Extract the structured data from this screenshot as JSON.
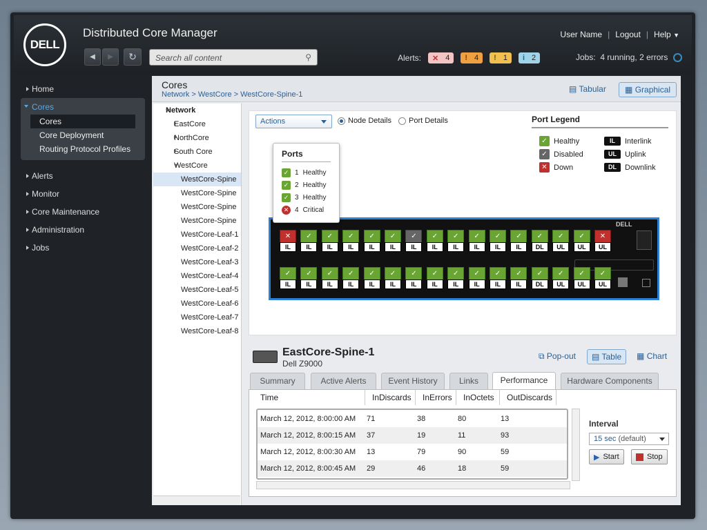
{
  "header": {
    "logo": "DELL",
    "app_title": "Distributed Core Manager",
    "user": "User Name",
    "logout": "Logout",
    "help": "Help",
    "search_placeholder": "Search all content",
    "alerts_label": "Alerts:",
    "alerts": [
      {
        "icon": "✕",
        "count": "4",
        "color": "#f3c4c4"
      },
      {
        "icon": "!",
        "count": "4",
        "color": "#f0a040"
      },
      {
        "icon": "!",
        "count": "1",
        "color": "#f2c050"
      },
      {
        "icon": "i",
        "count": "2",
        "color": "#9fd3e8"
      }
    ],
    "jobs": "Jobs:",
    "jobs_text": "4 running, 2 errors"
  },
  "sidebar": {
    "home": "Home",
    "cores": "Cores",
    "cores_sub": [
      "Cores",
      "Core Deployment",
      "Routing Protocol Profiles"
    ],
    "rest": [
      "Alerts",
      "Monitor",
      "Core Maintenance",
      "Administration",
      "Jobs"
    ]
  },
  "content": {
    "title": "Cores",
    "breadcrumb": "Network > WestCore > WestCore-Spine-1",
    "tabular": "Tabular",
    "graphical": "Graphical"
  },
  "tree": {
    "root": "Network",
    "nodes": [
      "EastCore",
      "NorthCore",
      "South Core",
      "WestCore"
    ],
    "children": [
      "WestCore-Spine",
      "WestCore-Spine",
      "WestCore-Spine",
      "WestCore-Spine",
      "WestCore-Leaf-1",
      "WestCore-Leaf-2",
      "WestCore-Leaf-3",
      "WestCore-Leaf-4",
      "WestCore-Leaf-5",
      "WestCore-Leaf-6",
      "WestCore-Leaf-7",
      "WestCore-Leaf-8"
    ]
  },
  "graphic": {
    "actions": "Actions",
    "node_details": "Node Details",
    "port_details": "Port Details",
    "legend_title": "Port Legend",
    "legend": [
      {
        "label": "Healthy",
        "color": "#6aa534",
        "icon": "✓"
      },
      {
        "label": "Disabled",
        "color": "#666666",
        "icon": "✓"
      },
      {
        "label": "Down",
        "color": "#c0302c",
        "icon": "✕"
      }
    ],
    "tags": [
      {
        "tag": "IL",
        "label": "Interlink"
      },
      {
        "tag": "UL",
        "label": "Uplink"
      },
      {
        "tag": "DL",
        "label": "Downlink"
      }
    ],
    "switch_brand": "DELL",
    "popup_title": "Ports",
    "popup_rows": [
      {
        "n": "1",
        "status": "Healthy",
        "color": "#6aa534",
        "icon": "✓"
      },
      {
        "n": "2",
        "status": "Healthy",
        "color": "#6aa534",
        "icon": "✓"
      },
      {
        "n": "3",
        "status": "Healthy",
        "color": "#6aa534",
        "icon": "✓"
      },
      {
        "n": "4",
        "status": "Critical",
        "color": "#c0302c",
        "icon": "✕"
      }
    ],
    "top_row_tags": [
      "IL",
      "IL",
      "IL",
      "IL",
      "IL",
      "IL",
      "IL",
      "IL",
      "IL",
      "IL",
      "IL",
      "IL",
      "DL",
      "UL",
      "UL",
      "UL"
    ],
    "bottom_row_tags": [
      "IL",
      "IL",
      "IL",
      "IL",
      "IL",
      "IL",
      "IL",
      "IL",
      "IL",
      "IL",
      "IL",
      "IL",
      "DL",
      "UL",
      "UL",
      "UL"
    ]
  },
  "detail": {
    "title": "EastCore-Spine-1",
    "model": "Dell Z9000",
    "popout": "Pop-out",
    "table": "Table",
    "chart": "Chart",
    "tabs": [
      "Summary",
      "Active Alerts",
      "Event History",
      "Links",
      "Performance",
      "Hardware Components"
    ],
    "columns": [
      "Time",
      "InDiscards",
      "InErrors",
      "InOctets",
      "OutDiscards"
    ],
    "rows": [
      [
        "March 12, 2012, 8:00:00 AM",
        "71",
        "38",
        "80",
        "13"
      ],
      [
        "March 12, 2012, 8:00:15 AM",
        "37",
        "19",
        "11",
        "93"
      ],
      [
        "March 12, 2012, 8:00:30 AM",
        "13",
        "79",
        "90",
        "59"
      ],
      [
        "March 12, 2012, 8:00:45 AM",
        "29",
        "46",
        "18",
        "59"
      ]
    ],
    "interval_label": "Interval",
    "interval_value": "15 sec",
    "interval_default": "(default)",
    "start": "Start",
    "stop": "Stop"
  }
}
